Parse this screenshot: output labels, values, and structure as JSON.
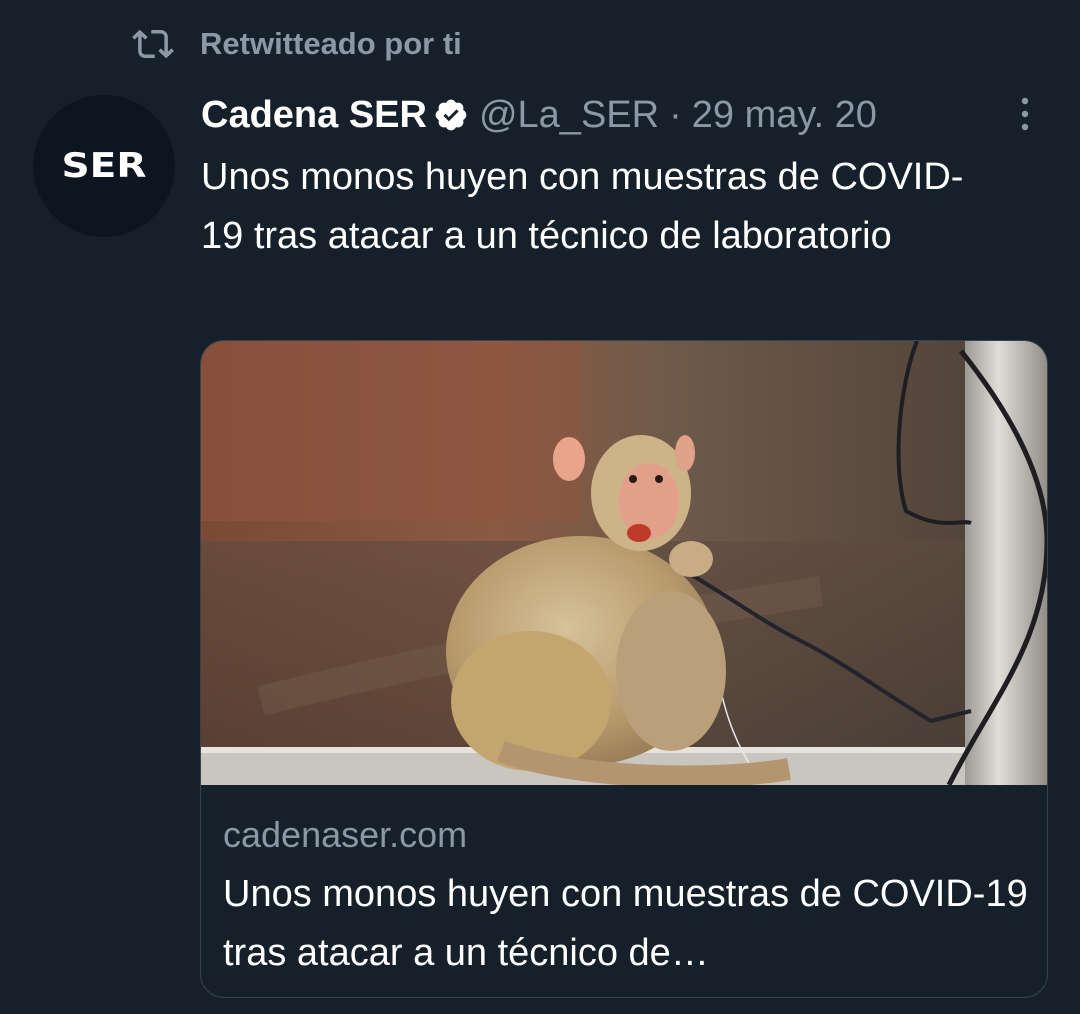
{
  "retweet": {
    "icon": "retweet-icon",
    "label": "Retwitteado por ti"
  },
  "tweet": {
    "author": {
      "name": "Cadena SER",
      "handle": "@La_SER",
      "verified": true,
      "avatar_text": "SER"
    },
    "separator": "·",
    "date": "29 may. 20",
    "text": "Unos monos huyen con muestras de COVID-19 tras atacar a un técnico de laboratorio",
    "card": {
      "domain": "cadenaser.com",
      "title": "Unos monos huyen con muestras de COVID-19 tras atacar a un técnico de…"
    }
  },
  "colors": {
    "background": "#15202b",
    "secondary_text": "#8b98a5",
    "border": "#38444d",
    "primary_text": "#ffffff"
  }
}
